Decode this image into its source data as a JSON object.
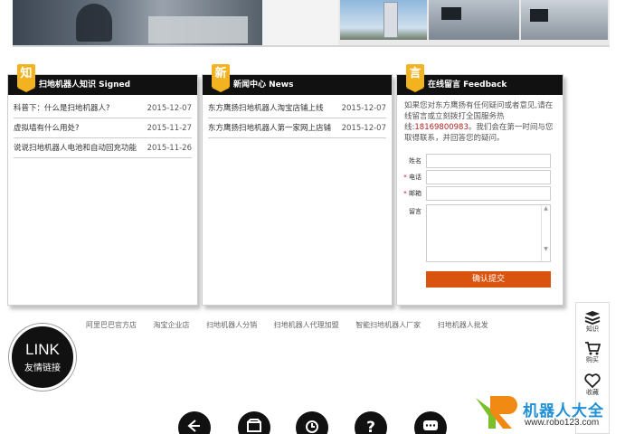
{
  "knowledge": {
    "badge": "知",
    "title": "扫地机器人知识 Signed",
    "items": [
      {
        "title": "科普下：什么是扫地机器人?",
        "date": "2015-12-07"
      },
      {
        "title": "虚拟墙有什么用处?",
        "date": "2015-11-27"
      },
      {
        "title": "说说扫地机器人电池和自动回充功能",
        "date": "2015-11-26"
      }
    ]
  },
  "news": {
    "badge": "新",
    "title": "新闻中心 News",
    "items": [
      {
        "title": "东方鹰扬扫地机器人淘宝店铺上线",
        "date": "2015-12-07"
      },
      {
        "title": "东方鹰扬扫地机器人第一家网上店铺",
        "date": "2015-12-07"
      }
    ]
  },
  "feedback": {
    "badge": "言",
    "title": "在线留言 Feedback",
    "intro": "如果您对东方鹰扬有任何疑问或者意见,请在线留言或立刻拨打全国服务热线:",
    "phone": "18169800983",
    "intro_tail": "。我们会在第一时间与您取得联系，并回答您的疑问。",
    "name_label": "姓名",
    "phone_label": "电话",
    "email_label": "邮箱",
    "message_label": "留言",
    "required_mark": "*",
    "submit": "确认提交"
  },
  "links": {
    "items": [
      "阿里巴巴官方店",
      "淘宝企业店",
      "扫地机器人分销",
      "扫地机器人代理加盟",
      "智能扫地机器人厂家",
      "扫地机器人批发"
    ],
    "circle_big": "LINK",
    "circle_small": "友情链接"
  },
  "sidebar": {
    "knowledge": "知识",
    "buy": "购买",
    "favorite": "收藏"
  },
  "logo": {
    "name": "机器人大全",
    "url": "www.robo123.com"
  }
}
